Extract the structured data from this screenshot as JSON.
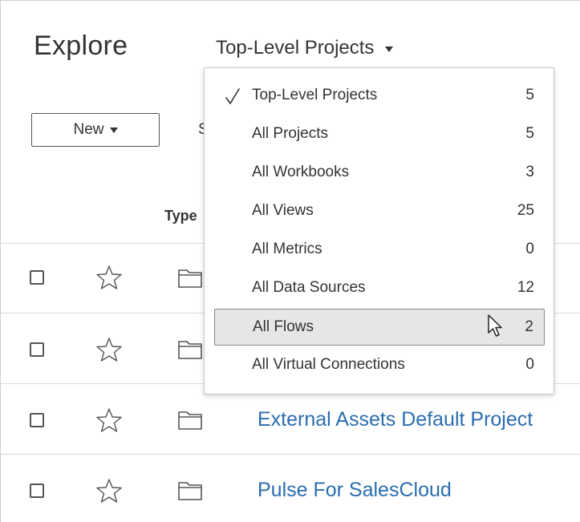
{
  "header": {
    "title": "Explore",
    "project_filter": "Top-Level Projects",
    "new_button_label": "New"
  },
  "partial_labels": {
    "toolbar_peek": "S",
    "type_column": "Type"
  },
  "dropdown": {
    "items": [
      {
        "label": "Top-Level Projects",
        "count": "5",
        "selected": true
      },
      {
        "label": "All Projects",
        "count": "5"
      },
      {
        "label": "All Workbooks",
        "count": "3"
      },
      {
        "label": "All Views",
        "count": "25"
      },
      {
        "label": "All Metrics",
        "count": "0"
      },
      {
        "label": "All Data Sources",
        "count": "12"
      },
      {
        "label": "All Flows",
        "count": "2",
        "hovered": true
      },
      {
        "label": "All Virtual Connections",
        "count": "0"
      }
    ]
  },
  "rows": [
    {
      "name": ""
    },
    {
      "name": ""
    },
    {
      "name": "External Assets Default Project"
    },
    {
      "name": "Pulse For SalesCloud"
    }
  ],
  "colors": {
    "link": "#2a6db0",
    "hover_background": "#e6e6e6",
    "text": "#333333"
  },
  "icons": {
    "checkmark": "check-icon",
    "favorite": "star-icon",
    "item_type": "folder-icon",
    "pointer": "mouse-cursor-icon"
  }
}
